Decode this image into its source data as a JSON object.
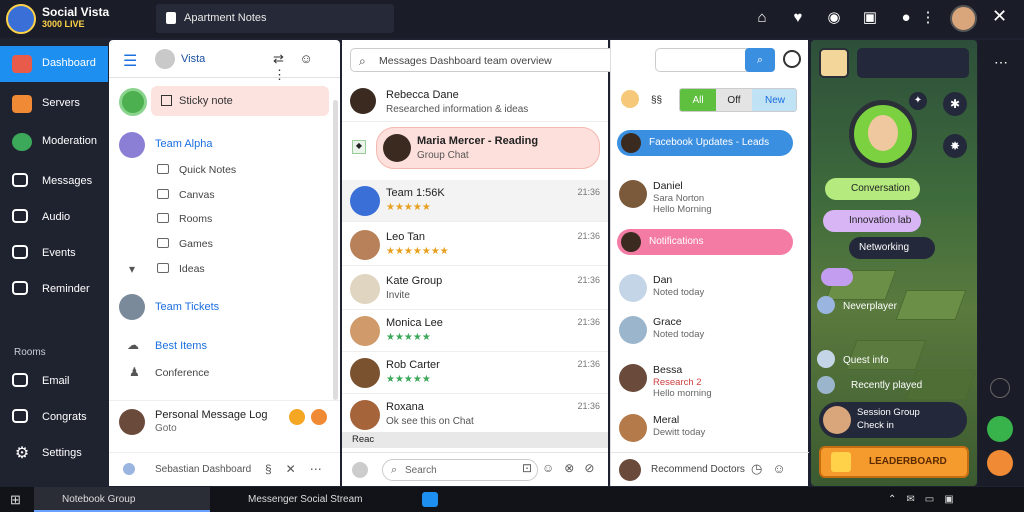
{
  "app": {
    "title": "Social Vista",
    "subtitle": "3000 LIVE"
  },
  "window_tab": "Apartment Notes",
  "leftnav": {
    "items": [
      {
        "label": "Dashboard",
        "icon": "dashboard-icon",
        "color": "#e85a4a",
        "active": true
      },
      {
        "label": "Servers",
        "icon": "servers-icon",
        "color": "#f08a34"
      },
      {
        "label": "Moderation",
        "icon": "tree-icon",
        "color": "#3ca85a"
      },
      {
        "label": "Messages",
        "icon": "messages-icon",
        "color": "#ffffff"
      },
      {
        "label": "Audio",
        "icon": "audio-icon",
        "color": "#ffffff"
      },
      {
        "label": "Events",
        "icon": "events-icon",
        "color": "#ffffff"
      },
      {
        "label": "Reminder",
        "icon": "reminder-icon",
        "color": "#ffffff"
      }
    ],
    "section": "Rooms",
    "bottom_items": [
      {
        "label": "Email",
        "icon": "email-icon"
      },
      {
        "label": "Congrats",
        "icon": "grid-icon"
      },
      {
        "label": "Settings",
        "icon": "gear-icon"
      }
    ]
  },
  "convside": {
    "title": "Vista",
    "sticky": "Sticky note",
    "group1": {
      "title": "Team Alpha",
      "items": [
        "Quick Notes",
        "Canvas",
        "Rooms",
        "Games",
        "Ideas"
      ]
    },
    "group2": {
      "title": "Team Tickets"
    },
    "group3": {
      "title": "Best Items"
    },
    "item_extra": "Conference",
    "footer_name": "Personal Message Log",
    "footer_sub": "Goto",
    "bottom": "Sebastian Dashboard"
  },
  "chatlist": {
    "search_placeholder": "Messages Dashboard team overview",
    "header_chat": {
      "name": "Rebecca Dane",
      "preview": "Researched information & ideas"
    },
    "pinned": {
      "name": "Maria Mercer - Reading",
      "preview": "Group Chat"
    },
    "rows": [
      {
        "name": "Team 1:56K",
        "preview": "★★★★★",
        "time": "21:36",
        "color": "#3a6fd8"
      },
      {
        "name": "Leo Tan",
        "preview": "★★★★★★★",
        "time": "21:36",
        "color": "#b8815a"
      },
      {
        "name": "Kate Group",
        "preview": "Invite",
        "time": "21:36",
        "color": "#e0d5c0"
      },
      {
        "name": "Monica Lee",
        "preview": "★★★★★",
        "time": "21:36",
        "color": "#d19a6a"
      },
      {
        "name": "Rob Carter",
        "preview": "★★★★★",
        "time": "21:36",
        "color": "#7a5230"
      },
      {
        "name": "Roxana",
        "preview": "Ok see this on Chat",
        "time": "21:36",
        "color": "#a5643a"
      }
    ],
    "reaction_label": "Reac",
    "compose_placeholder": "Search"
  },
  "colb": {
    "filters": [
      "All",
      "Off",
      "New"
    ],
    "pill1": "Facebook Updates - Leads",
    "pill2": "Notifications",
    "rows": [
      {
        "l1": "Daniel",
        "l2": "Sara Norton",
        "l3": "Hello Morning",
        "color": "#7a5a3a"
      },
      {
        "l1": "Dan",
        "l2": "Noted today",
        "l3": "",
        "color": "#c5d5e8"
      },
      {
        "l1": "Grace",
        "l2": "Noted today",
        "l3": "",
        "color": "#9ab5cc"
      },
      {
        "l1": "Bessa",
        "l2": "Research 2",
        "l3": "Hello morning",
        "color": "#6a4a3a"
      },
      {
        "l1": "Meral",
        "l2": "Dewitt today",
        "l3": "",
        "color": "#b57a4a"
      }
    ],
    "footer": "Recommend Doctors"
  },
  "game": {
    "bubbles": [
      "Conversation",
      "Innovation lab",
      "Networking"
    ],
    "labels": [
      "Neverplayer",
      "Quest info",
      "Recently played"
    ],
    "bottom_card": "Session Group",
    "bottom_card_sub": "Check in",
    "cta": "LEADERBOARD"
  },
  "taskbar": {
    "item1": "Notebook Group",
    "item2": "Messenger Social Stream"
  }
}
